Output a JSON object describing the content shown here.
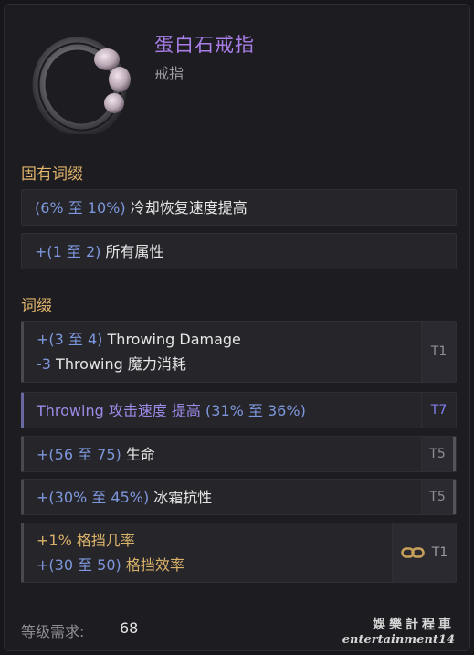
{
  "item": {
    "name": "蛋白石戒指",
    "type": "戒指"
  },
  "implicit": {
    "title": "固有词缀",
    "rows": [
      {
        "p1": "(6% 至 10%)",
        "p2": " 冷却恢复速度提高"
      },
      {
        "p1": "+(1 至 2)",
        "p2": " 所有属性"
      }
    ]
  },
  "affixes": {
    "title": "词缀",
    "rows": [
      {
        "line1_a": "+(3 至 4)",
        "line1_b": " Throwing Damage",
        "line2_a": "-3",
        "line2_b": " Throwing 魔力消耗",
        "tier": "T1"
      },
      {
        "line1_a": "Throwing 攻击速度 提高",
        "line1_b": " (31% 至 36%)",
        "tier": "T7"
      },
      {
        "line1_a": "+(56 至 75)",
        "line1_b": " 生命",
        "tier": "T5"
      },
      {
        "line1_a": "+(30% 至 45%)",
        "line1_b": " 冰霜抗性",
        "tier": "T5"
      },
      {
        "line1_a": "+1%",
        "line1_b": " 格挡几率",
        "line2_a": "+(30 至 50)",
        "line2_b": " 格挡效率",
        "tier": "T1",
        "icon": "chain-link-icon"
      }
    ]
  },
  "footer": {
    "label": "等级需求:",
    "value": "68"
  },
  "watermark": {
    "line1": "娛樂計程車",
    "line2": "entertainment14"
  },
  "colors": {
    "name": "#a97ee8",
    "section": "#e0b46c",
    "range": "#7d97dc",
    "tier_t7": "#7f7ff0"
  }
}
